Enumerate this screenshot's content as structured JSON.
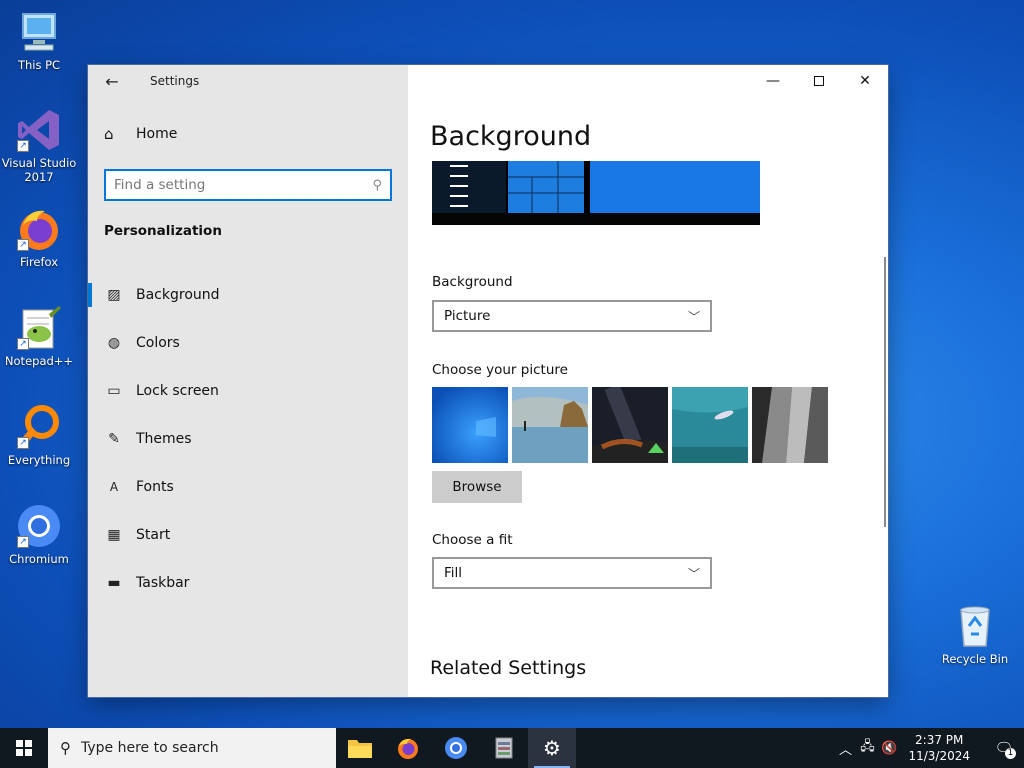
{
  "desktop": {
    "icons": [
      {
        "label": "This PC"
      },
      {
        "label": "Visual Studio 2017"
      },
      {
        "label": "Firefox"
      },
      {
        "label": "Notepad++"
      },
      {
        "label": "Everything"
      },
      {
        "label": "Chromium"
      },
      {
        "label": "Recycle Bin"
      }
    ]
  },
  "window": {
    "app_title": "Settings",
    "sidebar": {
      "home_label": "Home",
      "search_placeholder": "Find a setting",
      "section_title": "Personalization",
      "items": [
        {
          "label": "Background",
          "icon": "picture-icon",
          "active": true
        },
        {
          "label": "Colors",
          "icon": "palette-icon"
        },
        {
          "label": "Lock screen",
          "icon": "lock-screen-icon"
        },
        {
          "label": "Themes",
          "icon": "brush-icon"
        },
        {
          "label": "Fonts",
          "icon": "font-icon"
        },
        {
          "label": "Start",
          "icon": "start-icon"
        },
        {
          "label": "Taskbar",
          "icon": "taskbar-icon"
        }
      ]
    },
    "content": {
      "page_title": "Background",
      "background_label": "Background",
      "background_value": "Picture",
      "choose_picture_label": "Choose your picture",
      "browse_label": "Browse",
      "fit_label": "Choose a fit",
      "fit_value": "Fill",
      "related_title": "Related Settings"
    }
  },
  "taskbar": {
    "search_placeholder": "Type here to search",
    "clock_time": "2:37 PM",
    "clock_date": "11/3/2024",
    "notification_count": "1"
  },
  "colors": {
    "accent": "#0078d7",
    "taskbar": "#101820",
    "sidebar": "#e6e6e6"
  }
}
